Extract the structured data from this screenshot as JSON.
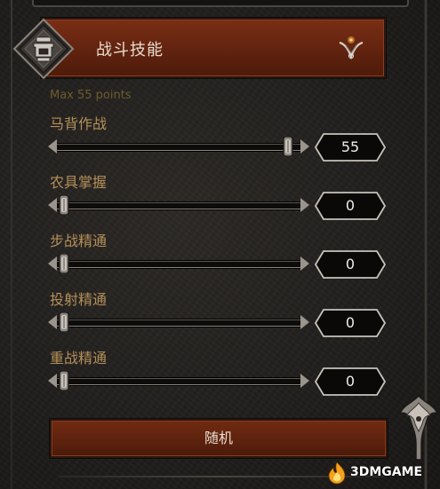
{
  "header": {
    "title": "战斗技能",
    "emblem_icon": "shield-emblem-icon",
    "expand_icon": "chevron-down-icon"
  },
  "max_points_label": "Max 55 points",
  "skills": [
    {
      "label": "马背作战",
      "value": "55",
      "level_fraction": 1.0
    },
    {
      "label": "农具掌握",
      "value": "0",
      "level_fraction": 0.0
    },
    {
      "label": "步战精通",
      "value": "0",
      "level_fraction": 0.0
    },
    {
      "label": "投射精通",
      "value": "0",
      "level_fraction": 0.0
    },
    {
      "label": "重战精通",
      "value": "0",
      "level_fraction": 0.0
    }
  ],
  "random_button_label": "随机",
  "watermark": {
    "text": "3DMGAME"
  },
  "colors": {
    "banner": "#61230f",
    "label": "#b49058",
    "max_label": "#6f5a2e",
    "value_text": "#f0ece6",
    "background": "#211f1d"
  }
}
